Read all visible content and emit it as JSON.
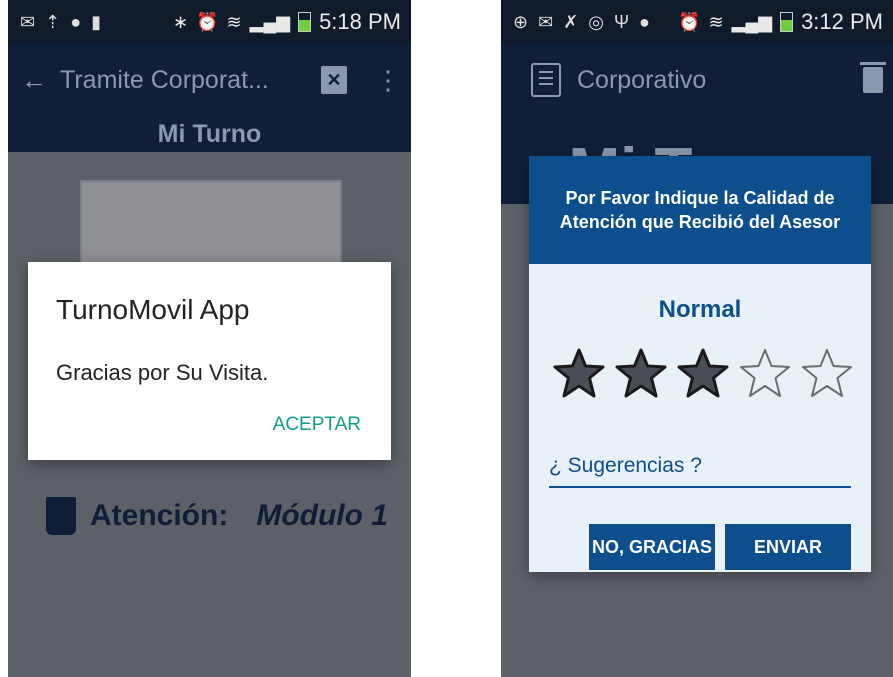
{
  "left_screen": {
    "status_bar": {
      "time": "5:18 PM",
      "icons": [
        "mail-icon",
        "upload-icon",
        "app-icon",
        "sim-icon",
        "bluetooth-icon",
        "alarm-icon",
        "wifi-icon",
        "signal-icon",
        "battery-icon"
      ]
    },
    "app_bar": {
      "title": "Tramite Corporat...",
      "back_icon": "arrow-left-icon",
      "ticket_icon": "ticket-icon",
      "menu_icon": "overflow-menu-icon"
    },
    "screen_title": "Mi Turno",
    "attention": {
      "label": "Atención:",
      "value": "Módulo 1"
    },
    "alert": {
      "title": "TurnoMovil App",
      "message": "Gracias por Su Visita.",
      "button": "ACEPTAR"
    }
  },
  "right_screen": {
    "status_bar": {
      "time": "3:12 PM",
      "icons": [
        "plus-icon",
        "mail-icon",
        "missed-call-icon",
        "whatsapp-icon",
        "usb-icon",
        "app-icon",
        "alarm-icon",
        "wifi-icon",
        "signal-icon",
        "battery-charging-icon"
      ]
    },
    "app_bar": {
      "title": "Corporativo",
      "doc_icon": "document-icon",
      "trash_icon": "trash-icon"
    },
    "behind_title": "Mi Turno",
    "rating": {
      "header": "Por Favor Indique la Calidad de Atención que Recibió del Asesor",
      "level": "Normal",
      "stars_filled": 3,
      "stars_total": 5,
      "suggestion_placeholder": "¿ Sugerencias ?",
      "no_button": "NO, GRACIAS",
      "send_button": "ENVIAR"
    }
  },
  "colors": {
    "app_bar": "#0f1f3a",
    "dialog_blue": "#0d4f8c",
    "accent_teal": "#0f9e8a",
    "background_gray": "#5c6168"
  }
}
